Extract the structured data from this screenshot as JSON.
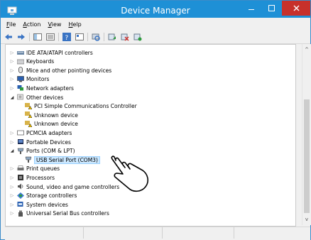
{
  "window": {
    "title": "Device Manager"
  },
  "menu": [
    {
      "label": "File"
    },
    {
      "label": "Action"
    },
    {
      "label": "View"
    },
    {
      "label": "Help"
    }
  ],
  "tree": [
    {
      "label": "IDE ATA/ATAPI controllers",
      "icon": "ide-controller-icon",
      "expander": "collapsed"
    },
    {
      "label": "Keyboards",
      "icon": "keyboard-icon",
      "expander": "collapsed"
    },
    {
      "label": "Mice and other pointing devices",
      "icon": "mouse-icon",
      "expander": "collapsed"
    },
    {
      "label": "Monitors",
      "icon": "monitor-icon",
      "expander": "collapsed"
    },
    {
      "label": "Network adapters",
      "icon": "network-adapter-icon",
      "expander": "collapsed"
    },
    {
      "label": "Other devices",
      "icon": "other-devices-icon",
      "expander": "expanded"
    },
    {
      "label": "PCI Simple Communications Controller",
      "icon": "unknown-device-warning-icon",
      "child": true
    },
    {
      "label": "Unknown device",
      "icon": "unknown-device-warning-icon",
      "child": true
    },
    {
      "label": "Unknown device",
      "icon": "unknown-device-warning-icon",
      "child": true
    },
    {
      "label": "PCMCIA adapters",
      "icon": "pcmcia-icon",
      "expander": "collapsed"
    },
    {
      "label": "Portable Devices",
      "icon": "portable-device-icon",
      "expander": "collapsed"
    },
    {
      "label": "Ports (COM & LPT)",
      "icon": "port-icon",
      "expander": "expanded"
    },
    {
      "label": "USB Serial Port (COM3)",
      "icon": "port-icon",
      "child": true,
      "selected": true
    },
    {
      "label": "Print queues",
      "icon": "printer-icon",
      "expander": "collapsed"
    },
    {
      "label": "Processors",
      "icon": "processor-icon",
      "expander": "collapsed"
    },
    {
      "label": "Sound, video and game controllers",
      "icon": "speaker-icon",
      "expander": "collapsed"
    },
    {
      "label": "Storage controllers",
      "icon": "storage-icon",
      "expander": "collapsed"
    },
    {
      "label": "System devices",
      "icon": "system-device-icon",
      "expander": "collapsed"
    },
    {
      "label": "Universal Serial Bus controllers",
      "icon": "usb-icon",
      "expander": "collapsed"
    }
  ],
  "colors": {
    "titlebar": "#1e90d6",
    "close": "#c7312b",
    "selection": "#cce8ff"
  }
}
